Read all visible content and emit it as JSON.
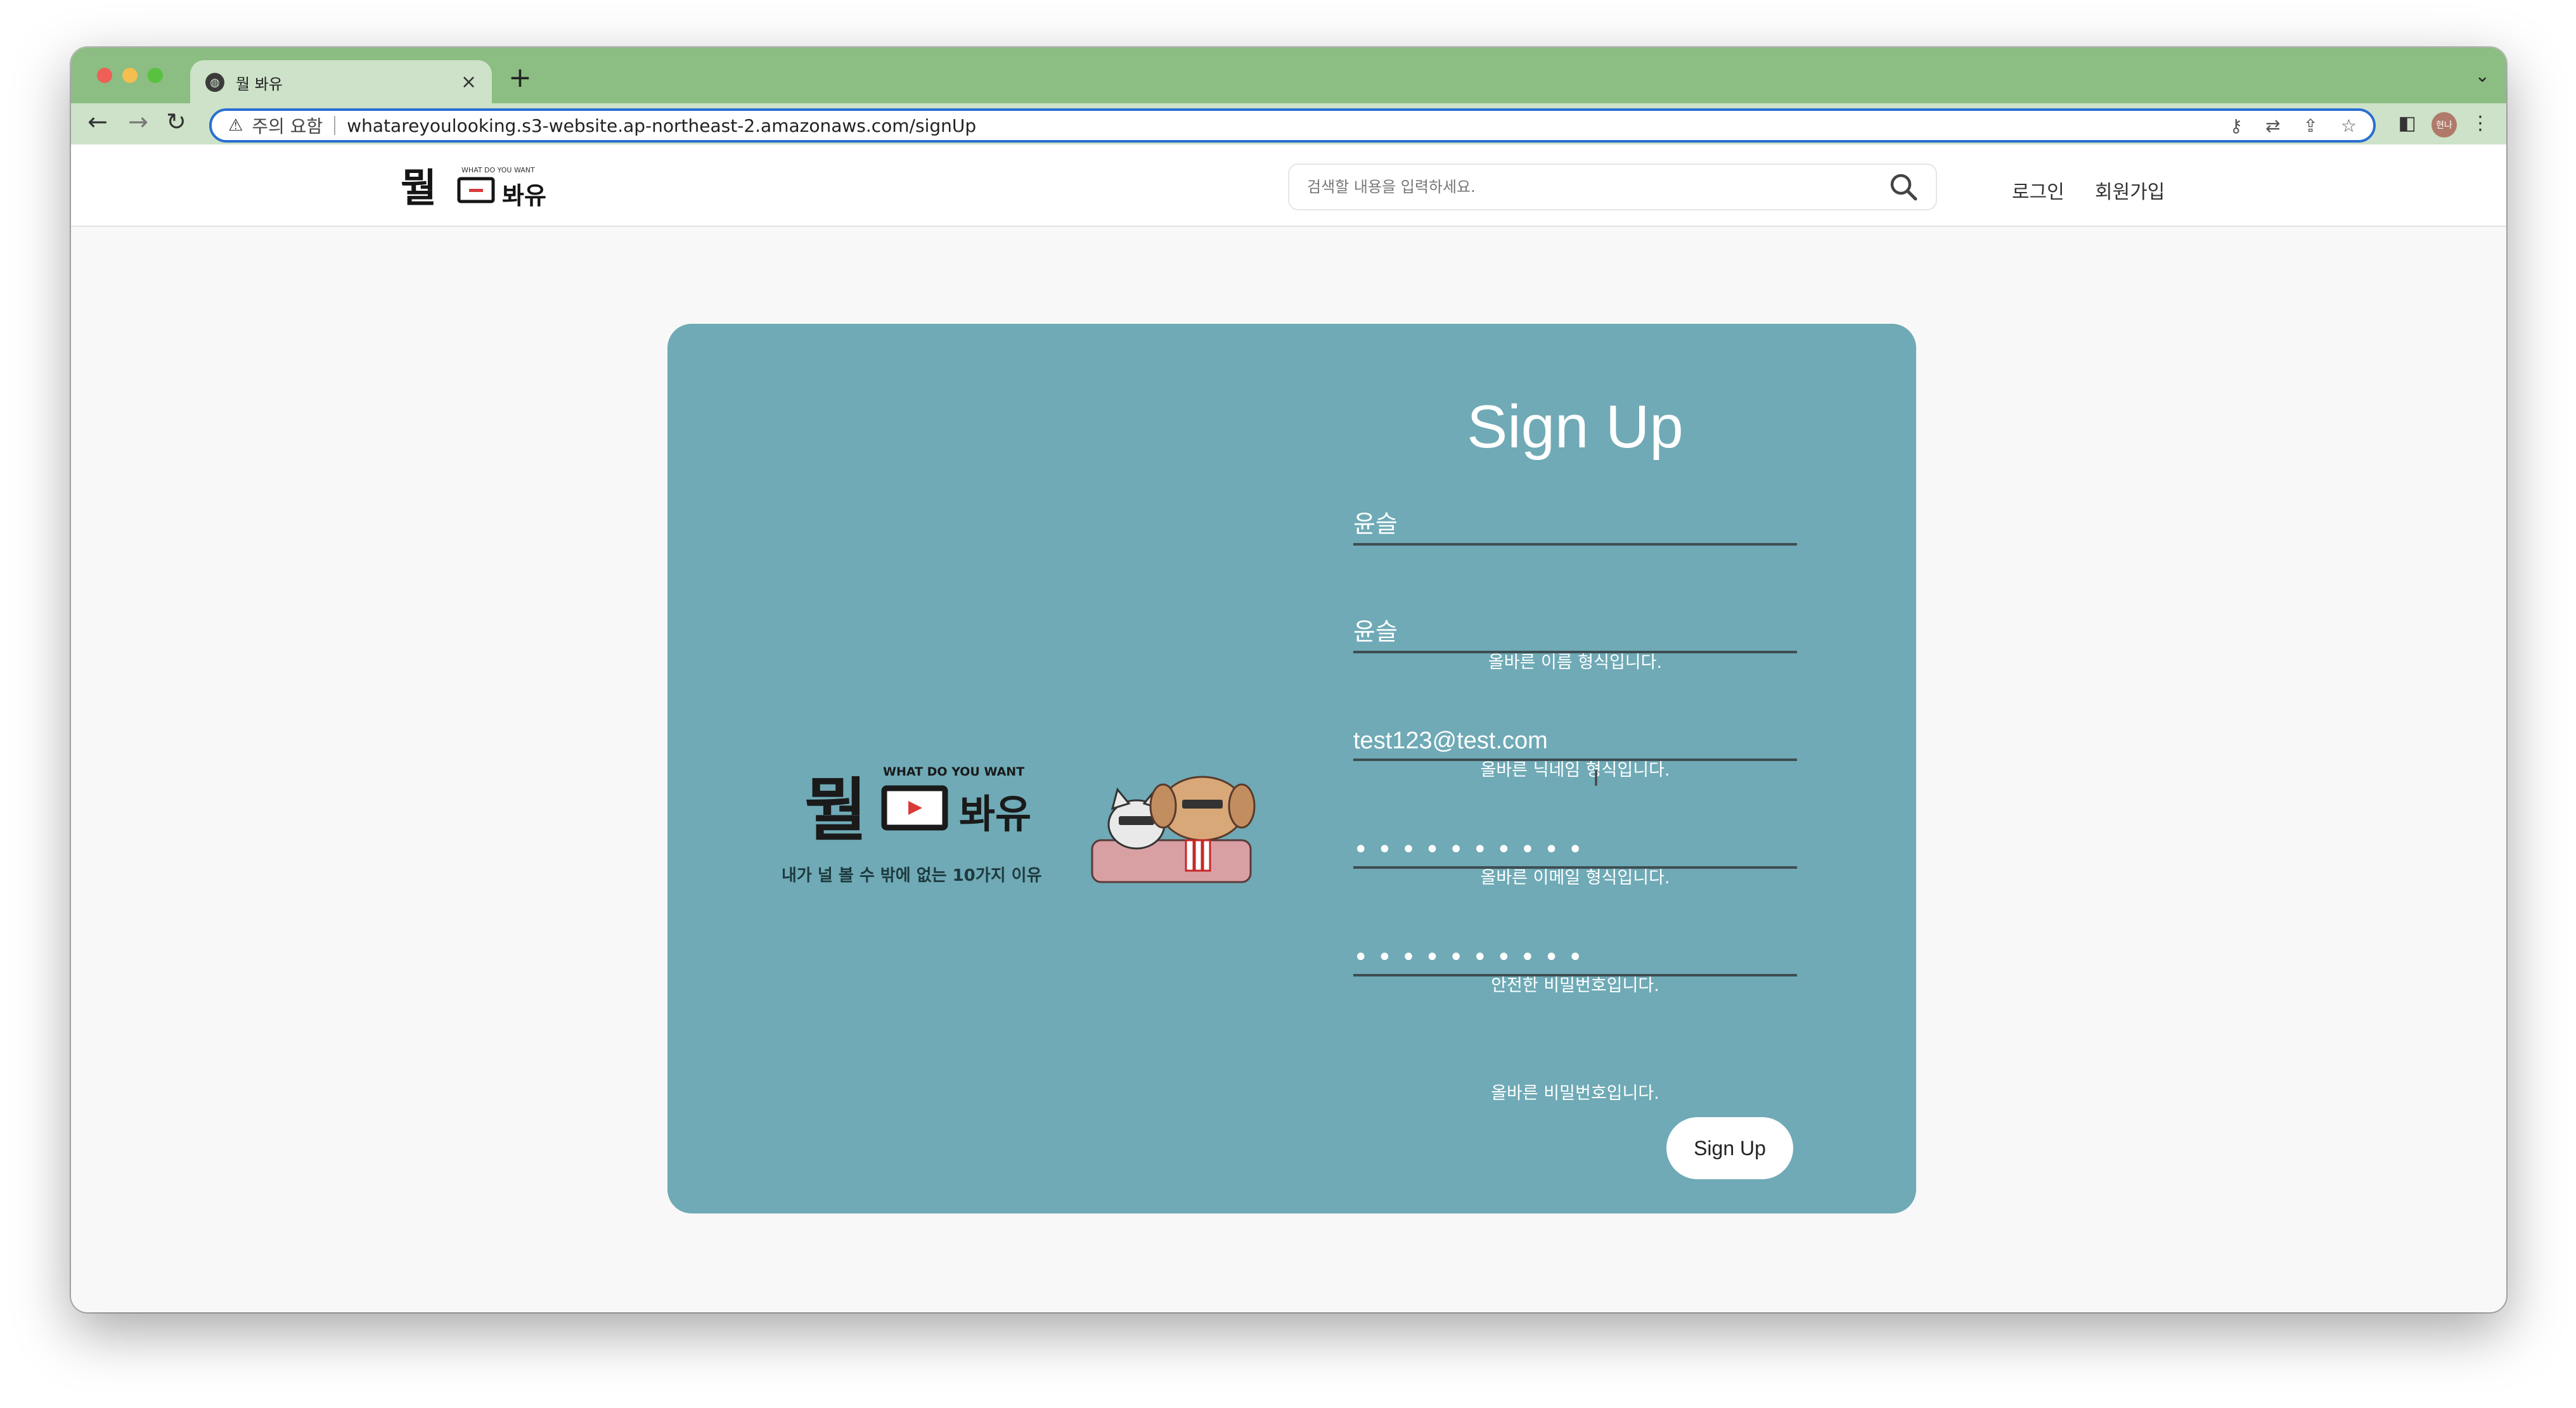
{
  "browser": {
    "tab_title": "뭘 봐유",
    "new_tab": "+",
    "tab_close": "×",
    "omnibox": {
      "warning_label": "주의 요함",
      "url": "whatareyoulooking.s3-website.ap-northeast-2.amazonaws.com/signUp"
    },
    "profile_initials": "현나"
  },
  "header": {
    "logo_text": "뭘 봐유",
    "search_placeholder": "검색할 내용을 입력하세요.",
    "nav": {
      "login": "로그인",
      "signup": "회원가입"
    }
  },
  "hero": {
    "logo_arc_text": "WHAT DO YOU WANT",
    "logo_main": "뭘",
    "logo_sub": "봐유",
    "tagline": "내가 널 볼 수 밖에 없는 10가지 이유"
  },
  "form": {
    "title": "Sign Up",
    "fields": [
      {
        "value": "윤슬",
        "hint": "올바른 이름 형식입니다."
      },
      {
        "value": "윤슬",
        "hint": "올바른 닉네임 형식입니다."
      },
      {
        "value": "test123@test.com",
        "hint": "올바른 이메일 형식입니다."
      },
      {
        "value": "••••••••••",
        "hint": "안전한 비밀번호입니다."
      },
      {
        "value": "••••••••••",
        "hint": "올바른 비밀번호입니다."
      }
    ],
    "submit_label": "Sign Up"
  },
  "colors": {
    "tab_strip": "#8cbd82",
    "toolbar": "#cde2c8",
    "card": "#6faab6",
    "underline": "#3e4d52"
  }
}
